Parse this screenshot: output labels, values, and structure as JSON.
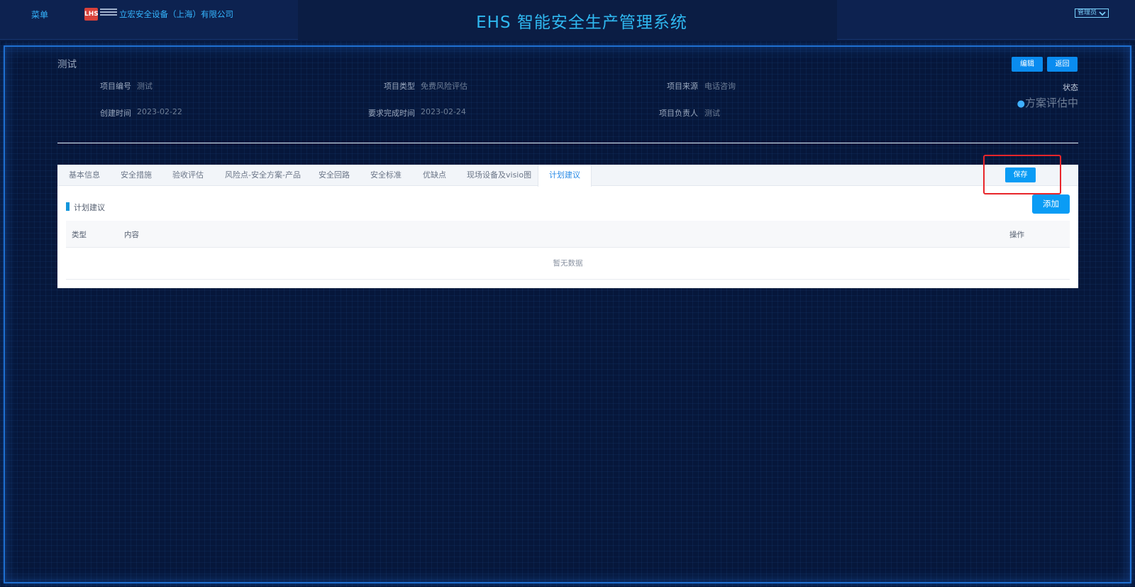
{
  "header": {
    "menu_label": "菜单",
    "logo_badge": "LHS",
    "company_name": "立宏安全设备（上海）有限公司",
    "system_title": "EHS 智能安全生产管理系统",
    "user_label": "管理员"
  },
  "project": {
    "title": "测试",
    "edit_label": "编辑",
    "back_label": "返回",
    "fields": {
      "code_label": "项目编号",
      "code_value": "测试",
      "type_label": "项目类型",
      "type_value": "免费风险评估",
      "source_label": "项目来源",
      "source_value": "电话咨询",
      "created_label": "创建时间",
      "created_value": "2023-02-22",
      "due_label": "要求完成时间",
      "due_value": "2023-02-24",
      "owner_label": "项目负责人",
      "owner_value": "测试"
    },
    "status_label": "状态",
    "status_value": "方案评估中"
  },
  "tabs": [
    {
      "label": "基本信息"
    },
    {
      "label": "安全措施"
    },
    {
      "label": "验收评估"
    },
    {
      "label": "风险点-安全方案-产品"
    },
    {
      "label": "安全回路"
    },
    {
      "label": "安全标准"
    },
    {
      "label": "优缺点"
    },
    {
      "label": "现场设备及visio图"
    },
    {
      "label": "计划建议",
      "active": true
    }
  ],
  "save_label": "保存",
  "section": {
    "title": "计划建议",
    "add_label": "添加"
  },
  "table": {
    "columns": [
      "类型",
      "内容",
      "操作"
    ],
    "empty_text": "暂无数据"
  },
  "colors": {
    "accent": "#0a9cf5",
    "background": "#06173b",
    "highlight": "#e8262b"
  }
}
